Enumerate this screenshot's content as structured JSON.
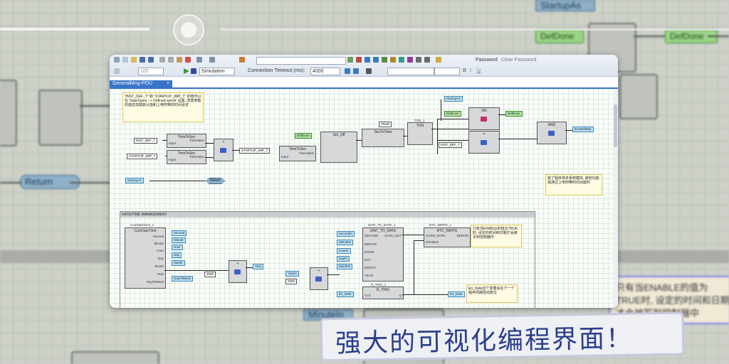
{
  "window": {
    "tab_label": "GeneralMng-POU",
    "toolbar": {
      "mode_value": "Simulation",
      "timeout_label": "Connection Timeout (ms):",
      "timeout_value": "4000",
      "password_label": "Password",
      "clear_password_label": "Clear Password",
      "zoom_value": "100"
    }
  },
  "diagram_top": {
    "note_text": "\"INST_DEF_T\" 和 \"STARTUP_JMP_T\" 的值可以在 'DataTypes --> Defined words' 设置, 改变参数的值去加载默认值和上电附带的时间设定",
    "labels": {
      "inst_def_t": "INST_DEF_T",
      "startup_jmp_t": "STARTUP_JMP_T",
      "startup_jmp_t2": "STARTUP_JMP_T",
      "inst_def_t2": "INST_DEF_T",
      "time_to_sec": "TimeToSec",
      "input": "Input",
      "time_value": "TimeValue",
      "set_off": "Set_Off",
      "set_to_time": "SecToTime",
      "true_const": "TRUE",
      "ton": "TON",
      "ton_inst": "TON_1",
      "or": "OR",
      "and": "AND",
      "def_done": "DefDone",
      "def_done2": "DefDone",
      "startup_var": "StartupAs",
      "env_def_mode": "EnvDefMde",
      "startup_in": "StartupAs",
      "return": "Return"
    },
    "note2_text": "除了程序将本系统模块, 其他功能需通过上电附带时间功能时"
  },
  "section_time": {
    "header": "DATE/TIME MANAGEMENT",
    "fb_name": "CurrDateTime_1",
    "fb_type": "CurrDateTime",
    "outputs": [
      "Second",
      "Minute",
      "Hour",
      "Day",
      "Month",
      "Year",
      "DayOfWeek"
    ],
    "out_vars": [
      "Second",
      "Minute",
      "Hour",
      "Day",
      "Month",
      "DayOfWeek"
    ],
    "year_offset": "2000",
    "year_var": "Year",
    "year_in": "YearIn",
    "year_offset2": "2000",
    "uint_to_date": "UINT_TO_DATE_1",
    "uint_to_date_type": "UINT_TO_DATE",
    "date_inputs": [
      "SECOND",
      "MINUTE",
      "HOUR",
      "DAY",
      "MONTH",
      "YEAR"
    ],
    "date_out": "DATE_OUT",
    "in_vars": [
      "SecondIn",
      "MinuteIn",
      "HourIn",
      "DayIn",
      "MonthIn"
    ],
    "rtc_write": "RTC_WRITE_1",
    "rtc_write_type": "RTC_WRITE",
    "curr_date": "CURR_DATE",
    "enable": "ENABLE",
    "error": "ERROR",
    "r_trig": "R_TRIG_1",
    "r_trig_type": "R_TRIG",
    "clk": "CLK",
    "q": "Q",
    "en_date": "En_Date",
    "en_date2": "En_Date",
    "note_a": "只有当ENABLE的值为TRUE时, 设定的时间和日期才会被写到控制器中",
    "note_b": "En_Date这个变量会在下一个程序周期自动复位"
  },
  "background": {
    "return_label": "Return",
    "def_done": "DefDone",
    "startup": "StartupAs",
    "or_label": "OR",
    "ton_label": "TON_1",
    "note_text": "只有当ENABLE的值为TRUE时, 设定的时间和日期才会被写到控制器中",
    "minute_in": "MinuteIn"
  },
  "caption": "强大的可视化编程界面！"
}
